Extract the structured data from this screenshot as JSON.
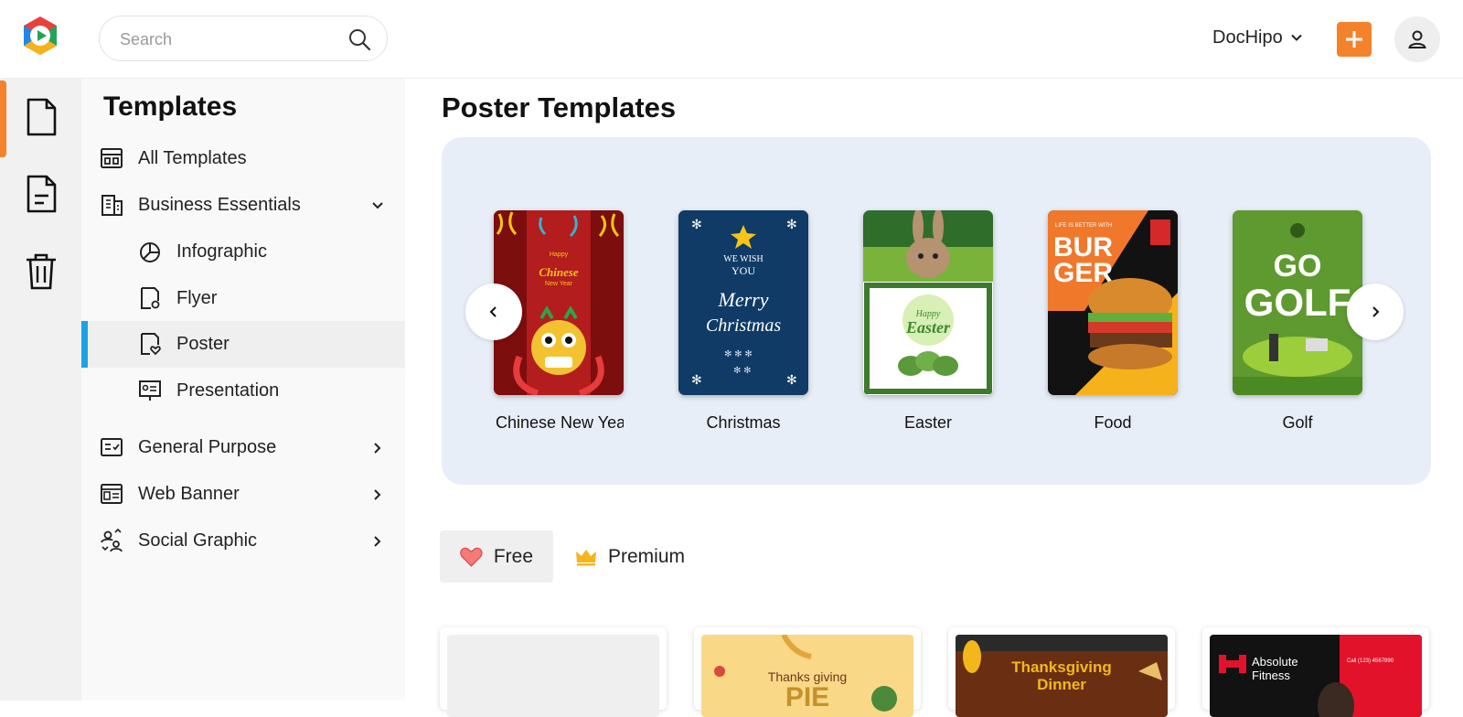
{
  "header": {
    "search_placeholder": "Search",
    "workspace_label": "DocHipo",
    "accent_color": "#f4822a"
  },
  "rail": {
    "items": [
      "document-icon",
      "file-text-icon",
      "trash-icon"
    ]
  },
  "sidebar": {
    "title": "Templates",
    "items": [
      {
        "label": "All Templates",
        "icon": "layout-grid-icon"
      },
      {
        "label": "Business Essentials",
        "icon": "building-icon",
        "expanded": true
      },
      {
        "label": "Infographic",
        "icon": "pie-chart-icon"
      },
      {
        "label": "Flyer",
        "icon": "flyer-icon"
      },
      {
        "label": "Poster",
        "icon": "poster-heart-icon",
        "selected": true
      },
      {
        "label": "Presentation",
        "icon": "presentation-icon"
      },
      {
        "label": "General Purpose",
        "icon": "checklist-icon"
      },
      {
        "label": "Web Banner",
        "icon": "banner-icon"
      },
      {
        "label": "Social Graphic",
        "icon": "users-share-icon"
      }
    ]
  },
  "main": {
    "title": "Poster Templates",
    "carousel": {
      "items": [
        {
          "label": "Chinese New Year",
          "thumb_text": "Happy Chinese New Year"
        },
        {
          "label": "Christmas",
          "thumb_text": "We Wish You A Merry Christmas"
        },
        {
          "label": "Easter",
          "thumb_text": "Happy Easter"
        },
        {
          "label": "Food",
          "thumb_text": "BURGER",
          "thumb_subtext": "LIFE IS BETTER WITH"
        },
        {
          "label": "Golf",
          "thumb_text": "GO GOLF"
        }
      ]
    },
    "filters": [
      {
        "label": "Free",
        "active": true
      },
      {
        "label": "Premium",
        "active": false
      }
    ],
    "grid": [
      {
        "title": "",
        "subtitle": ""
      },
      {
        "title": "Thanks giving",
        "subtitle": "PIE"
      },
      {
        "title": "Thanksgiving Dinner",
        "subtitle": ""
      },
      {
        "title": "Absolute Fitness",
        "subtitle": "Call (123) 4567890"
      }
    ]
  }
}
